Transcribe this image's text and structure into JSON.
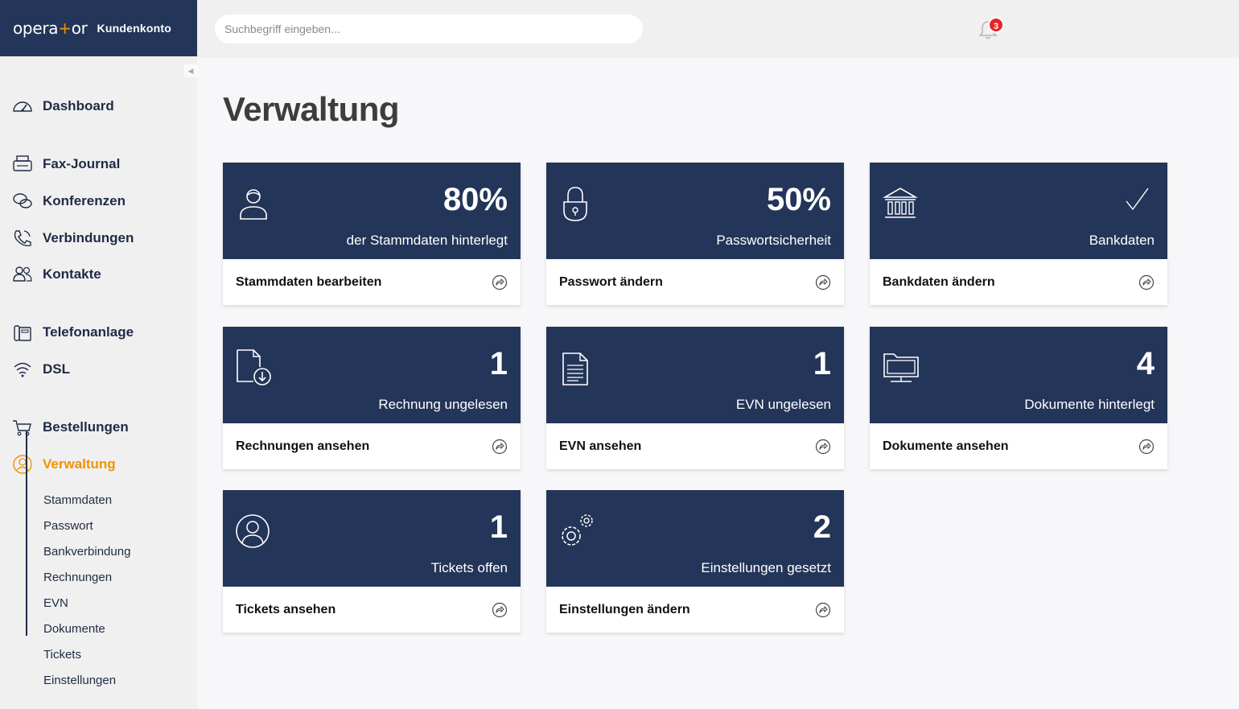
{
  "brand": {
    "logo_pre": "opera",
    "logo_plus": "+",
    "logo_post": "or",
    "account": "Kundenkonto"
  },
  "search": {
    "placeholder": "Suchbegriff eingeben..."
  },
  "notifications": {
    "count": "3"
  },
  "sidebar": {
    "items": [
      {
        "label": "Dashboard",
        "icon": "speedometer-icon"
      },
      {
        "label": "Fax-Journal",
        "icon": "fax-icon"
      },
      {
        "label": "Konferenzen",
        "icon": "chat-bubbles-icon"
      },
      {
        "label": "Verbindungen",
        "icon": "phone-call-icon"
      },
      {
        "label": "Kontakte",
        "icon": "users-icon"
      },
      {
        "label": "Telefonanlage",
        "icon": "telephone-system-icon"
      },
      {
        "label": "DSL",
        "icon": "wifi-icon"
      },
      {
        "label": "Bestellungen",
        "icon": "cart-icon"
      },
      {
        "label": "Verwaltung",
        "icon": "user-circle-icon",
        "active": true
      }
    ],
    "subitems": [
      "Stammdaten",
      "Passwort",
      "Bankverbindung",
      "Rechnungen",
      "EVN",
      "Dokumente",
      "Tickets",
      "Einstellungen"
    ],
    "accent_color": "#f39200"
  },
  "page": {
    "title": "Verwaltung"
  },
  "cards": [
    {
      "icon": "user-icon",
      "value": "80%",
      "caption": "der Stammdaten hinterlegt",
      "action": "Stammdaten bearbeiten"
    },
    {
      "icon": "lock-icon",
      "value": "50%",
      "caption": "Passwortsicherheit",
      "action": "Passwort ändern"
    },
    {
      "icon": "bank-icon",
      "value": "",
      "caption": "Bankdaten",
      "action": "Bankdaten ändern",
      "status_icon": "checkmark-icon"
    },
    {
      "icon": "invoice-download-icon",
      "value": "1",
      "caption": "Rechnung ungelesen",
      "action": "Rechnungen ansehen"
    },
    {
      "icon": "document-icon",
      "value": "1",
      "caption": "EVN ungelesen",
      "action": "EVN ansehen"
    },
    {
      "icon": "folder-monitor-icon",
      "value": "4",
      "caption": "Dokumente hinterlegt",
      "action": "Dokumente ansehen"
    },
    {
      "icon": "ticket-user-icon",
      "value": "1",
      "caption": "Tickets offen",
      "action": "Tickets ansehen"
    },
    {
      "icon": "gears-icon",
      "value": "2",
      "caption": "Einstellungen gesetzt",
      "action": "Einstellungen ändern"
    }
  ],
  "colors": {
    "navy": "#233558",
    "badge": "#e8242b"
  }
}
